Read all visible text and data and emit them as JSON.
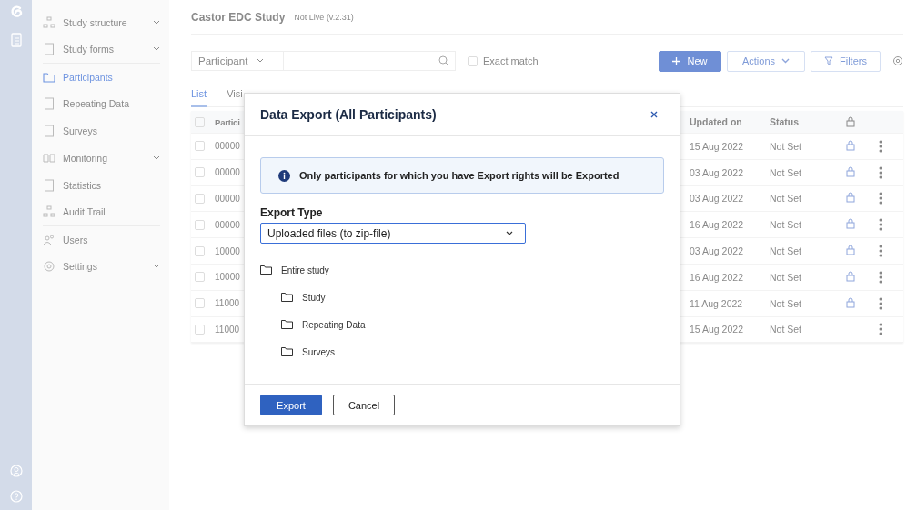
{
  "sidebar": {
    "groups": [
      {
        "items": [
          {
            "label": "Study structure",
            "expandable": true,
            "selected": false
          },
          {
            "label": "Study forms",
            "expandable": true,
            "selected": false
          }
        ]
      },
      {
        "items": [
          {
            "label": "Participants",
            "expandable": false,
            "selected": true
          },
          {
            "label": "Repeating Data",
            "expandable": false,
            "selected": false
          },
          {
            "label": "Surveys",
            "expandable": false,
            "selected": false
          }
        ]
      },
      {
        "items": [
          {
            "label": "Monitoring",
            "expandable": true,
            "selected": false
          },
          {
            "label": "Statistics",
            "expandable": false,
            "selected": false
          },
          {
            "label": "Audit Trail",
            "expandable": false,
            "selected": false
          }
        ]
      },
      {
        "items": [
          {
            "label": "Users",
            "expandable": false,
            "selected": false
          },
          {
            "label": "Settings",
            "expandable": true,
            "selected": false
          }
        ]
      }
    ]
  },
  "header": {
    "title": "Castor EDC Study",
    "status": "Not Live (v.2.31)"
  },
  "toolbar": {
    "search_by": "Participant",
    "exact_match": {
      "label": "Exact match",
      "checked": false
    },
    "buttons": [
      "New",
      "Actions",
      "Filters"
    ]
  },
  "tabs": [
    {
      "label": "List",
      "selected": true
    },
    {
      "label": "Visi",
      "selected": false
    }
  ],
  "table": {
    "columns": [
      "Partici",
      "Updated on",
      "Status"
    ],
    "all_checked": false,
    "rows": [
      {
        "checked": false,
        "id": "00000",
        "updated": "15 Aug 2022",
        "status": "Not Set",
        "locked": true
      },
      {
        "checked": false,
        "id": "00000",
        "updated": "03 Aug 2022",
        "status": "Not Set",
        "locked": true
      },
      {
        "checked": false,
        "id": "00000",
        "updated": "03 Aug 2022",
        "status": "Not Set",
        "locked": true
      },
      {
        "checked": false,
        "id": "00000",
        "updated": "16 Aug 2022",
        "status": "Not Set",
        "locked": true
      },
      {
        "checked": false,
        "id": "10000",
        "updated": "03 Aug 2022",
        "status": "Not Set",
        "locked": true
      },
      {
        "checked": false,
        "id": "10000",
        "updated": "16 Aug 2022",
        "status": "Not Set",
        "locked": true
      },
      {
        "checked": false,
        "id": "11000",
        "updated": "11 Aug 2022",
        "status": "Not Set",
        "locked": true
      },
      {
        "checked": false,
        "id": "11000",
        "updated": "15 Aug 2022",
        "status": "Not Set",
        "locked": false
      }
    ]
  },
  "dialog": {
    "title": "Data Export (All Participants)",
    "notice": "Only participants for which you have Export rights will be Exported",
    "export_type": {
      "label": "Export Type",
      "value": "Uploaded files (to zip-file)"
    },
    "tree": [
      {
        "label": "Entire study",
        "children": [
          {
            "label": "Study"
          },
          {
            "label": "Repeating Data"
          },
          {
            "label": "Surveys"
          }
        ]
      }
    ],
    "buttons": [
      {
        "label": "Export",
        "kind": "primary"
      },
      {
        "label": "Cancel",
        "kind": "secondary"
      }
    ]
  }
}
